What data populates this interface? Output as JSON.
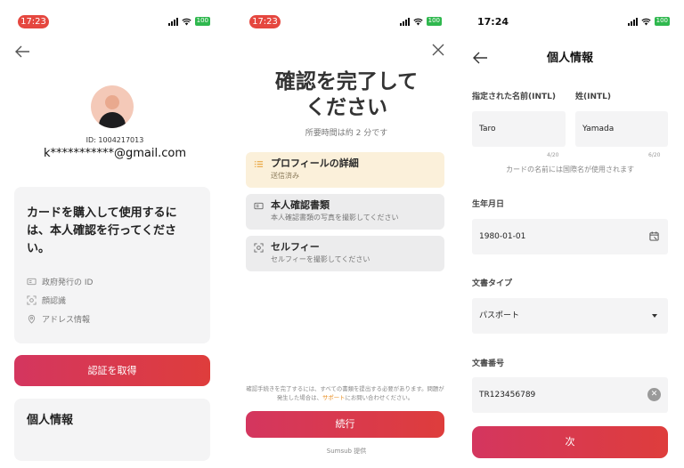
{
  "screen1": {
    "status": {
      "time": "17:23",
      "battery": "100"
    },
    "user_id": "ID: 1004217013",
    "email": "k***********@gmail.com",
    "verify_prompt": "カードを購入して使用するには、本人確認を行ってください。",
    "requirements": [
      {
        "icon": "id-card-icon",
        "label": "政府発行の ID"
      },
      {
        "icon": "face-scan-icon",
        "label": "顔認識"
      },
      {
        "icon": "location-pin-icon",
        "label": "アドレス情報"
      }
    ],
    "verify_button": "認証を取得",
    "personal_info_heading": "個人情報"
  },
  "screen2": {
    "status": {
      "time": "17:23",
      "battery": "100"
    },
    "title_line1": "確認を完了して",
    "title_line2": "ください",
    "duration": "所要時間は約 2 分です",
    "steps": [
      {
        "icon": "list-icon",
        "title": "プロフィールの詳細",
        "subtitle": "送信済み",
        "active": true
      },
      {
        "icon": "id-card-icon",
        "title": "本人確認書類",
        "subtitle": "本人確認書類の写真を撮影してください",
        "active": false
      },
      {
        "icon": "face-scan-icon",
        "title": "セルフィー",
        "subtitle": "セルフィーを撮影してください",
        "active": false
      }
    ],
    "notice_line1": "確認手続きを完了するには、すべての書類を提出する必要があります。問題が発生した場合は、",
    "notice_link": "サポート",
    "notice_line2": "にお問い合わせください。",
    "continue_button": "続行",
    "powered_by": "Sumsub 提供"
  },
  "screen3": {
    "status": {
      "time": "17:24",
      "battery": "100"
    },
    "title": "個人情報",
    "given_name_label": "指定された名前(INTL)",
    "given_name_value": "Taro",
    "given_name_counter": "4/20",
    "surname_label": "姓(INTL)",
    "surname_value": "Yamada",
    "surname_counter": "6/20",
    "name_hint": "カードの名前には国際名が使用されます",
    "dob_label": "生年月日",
    "dob_value": "1980-01-01",
    "doc_type_label": "文書タイプ",
    "doc_type_value": "パスポート",
    "doc_number_label": "文書番号",
    "doc_number_value": "TR123456789",
    "next_button": "次"
  },
  "colors": {
    "accent_gradient_start": "#d4365f",
    "accent_gradient_end": "#de3d3c",
    "time_pill": "#e5473f",
    "battery": "#2fb84e",
    "active_step_bg": "#fbf0da",
    "link": "#e88a1a"
  }
}
